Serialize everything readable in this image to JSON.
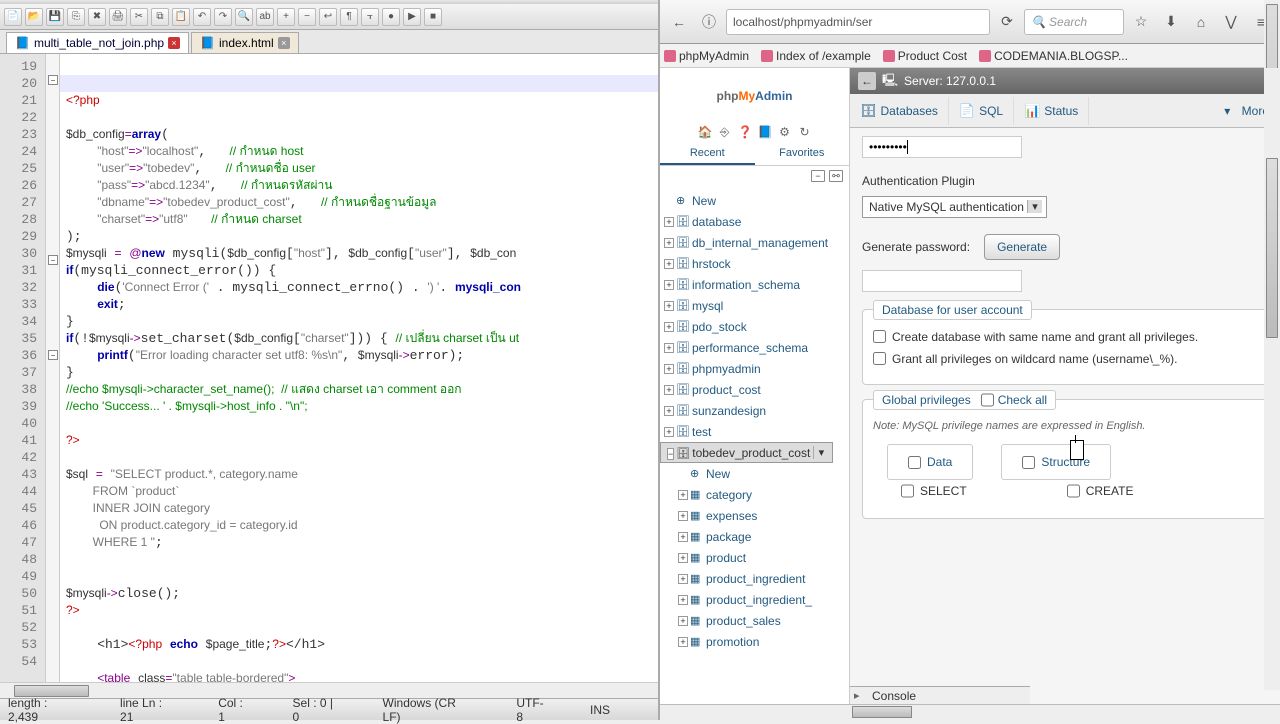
{
  "editor": {
    "tabs": [
      {
        "name": "multi_table_not_join.php",
        "active": true
      },
      {
        "name": "index.html",
        "active": false
      }
    ],
    "gutter_start": 19,
    "gutter_end": 54,
    "status": {
      "length": "length : 2,439",
      "lines": "line Ln : 21",
      "col": "Col : 1",
      "sel": "Sel : 0 | 0",
      "eol": "Windows (CR LF)",
      "enc": "UTF-8",
      "mode": "INS"
    }
  },
  "browser": {
    "url": "localhost/phpmyadmin/ser",
    "search_placeholder": "Search",
    "bookmarks": [
      "phpMyAdmin",
      "Index of /example",
      "Product Cost",
      "CODEMANIA.BLOGSP..."
    ]
  },
  "pma": {
    "server": "Server: 127.0.0.1",
    "tabs": [
      "Databases",
      "SQL",
      "Status",
      "More"
    ],
    "recent_label": "Recent",
    "fav_label": "Favorites",
    "tree": {
      "new": "New",
      "dbs": [
        "database",
        "db_internal_management",
        "hrstock",
        "information_schema",
        "mysql",
        "pdo_stock",
        "performance_schema",
        "phpmyadmin",
        "product_cost",
        "sunzandesign",
        "test"
      ],
      "open_db": "tobedev_product_cost",
      "open_children": [
        "New",
        "category",
        "expenses",
        "package",
        "product",
        "product_ingredient",
        "product_ingredient_",
        "product_sales",
        "promotion"
      ]
    },
    "form": {
      "password_masked": "•••••••••",
      "auth_label": "Authentication Plugin",
      "auth_value": "Native MySQL authentication",
      "genpass_label": "Generate password:",
      "gen_btn": "Generate",
      "db_user_legend": "Database for user account",
      "opt1": "Create database with same name and grant all privileges.",
      "opt2": "Grant all privileges on wildcard name (username\\_%).",
      "global_legend": "Global privileges",
      "checkall": "Check all",
      "note": "Note: MySQL privilege names are expressed in English.",
      "data_box": "Data",
      "struct_box": "Structure",
      "priv_select": "SELECT",
      "priv_create": "CREATE",
      "console": "Console"
    }
  }
}
